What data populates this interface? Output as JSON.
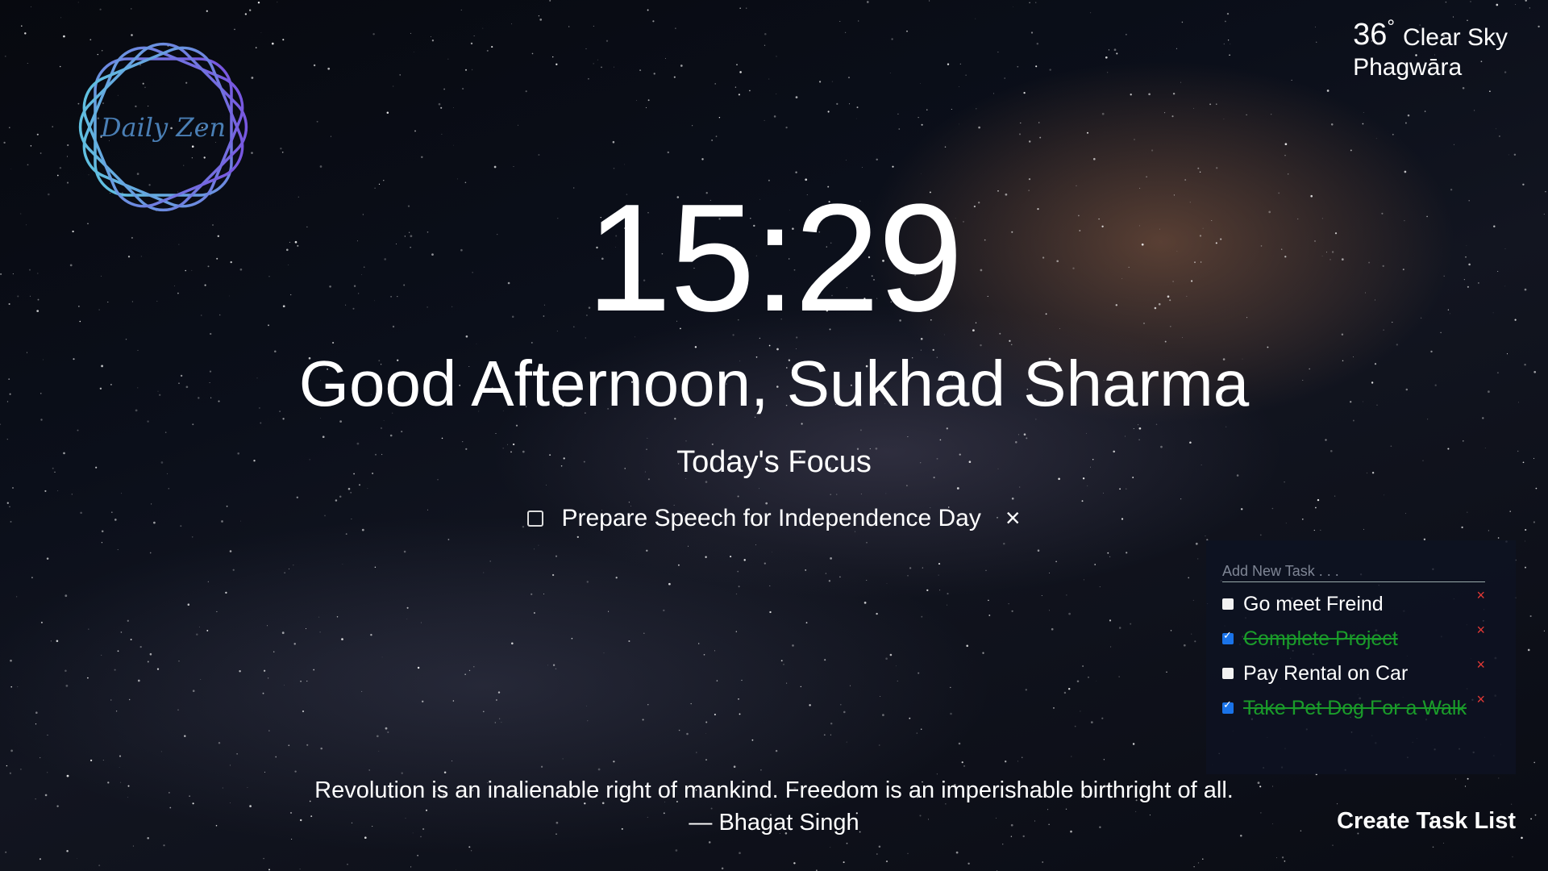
{
  "app": {
    "logo_text": "Daily Zen"
  },
  "weather": {
    "temperature": "36",
    "degree_symbol": "°",
    "condition": "Clear Sky",
    "location": "Phagwāra"
  },
  "clock": {
    "time": "15:29"
  },
  "greeting": "Good Afternoon, Sukhad Sharma",
  "focus": {
    "title": "Today's Focus",
    "task": "Prepare Speech for Independence Day",
    "checked": false,
    "close_icon": "×"
  },
  "task_panel": {
    "input_placeholder": "Add New Task . . .",
    "delete_icon": "×",
    "tasks": [
      {
        "label": "Go meet Freind",
        "done": false
      },
      {
        "label": "Complete Project",
        "done": true
      },
      {
        "label": "Pay Rental on Car",
        "done": false
      },
      {
        "label": "Take Pet Dog For a Walk",
        "done": true
      }
    ]
  },
  "quote": {
    "text": "Revolution is an inalienable right of mankind. Freedom is an imperishable birthright of all.",
    "author": "— Bhagat Singh"
  },
  "create_task_list_label": "Create Task List",
  "colors": {
    "done_task": "#1a9c2a",
    "delete": "#e53935",
    "checkbox_checked": "#1a73e8",
    "logo_gradient_start": "#5ec8e0",
    "logo_gradient_end": "#7a4fe0"
  }
}
